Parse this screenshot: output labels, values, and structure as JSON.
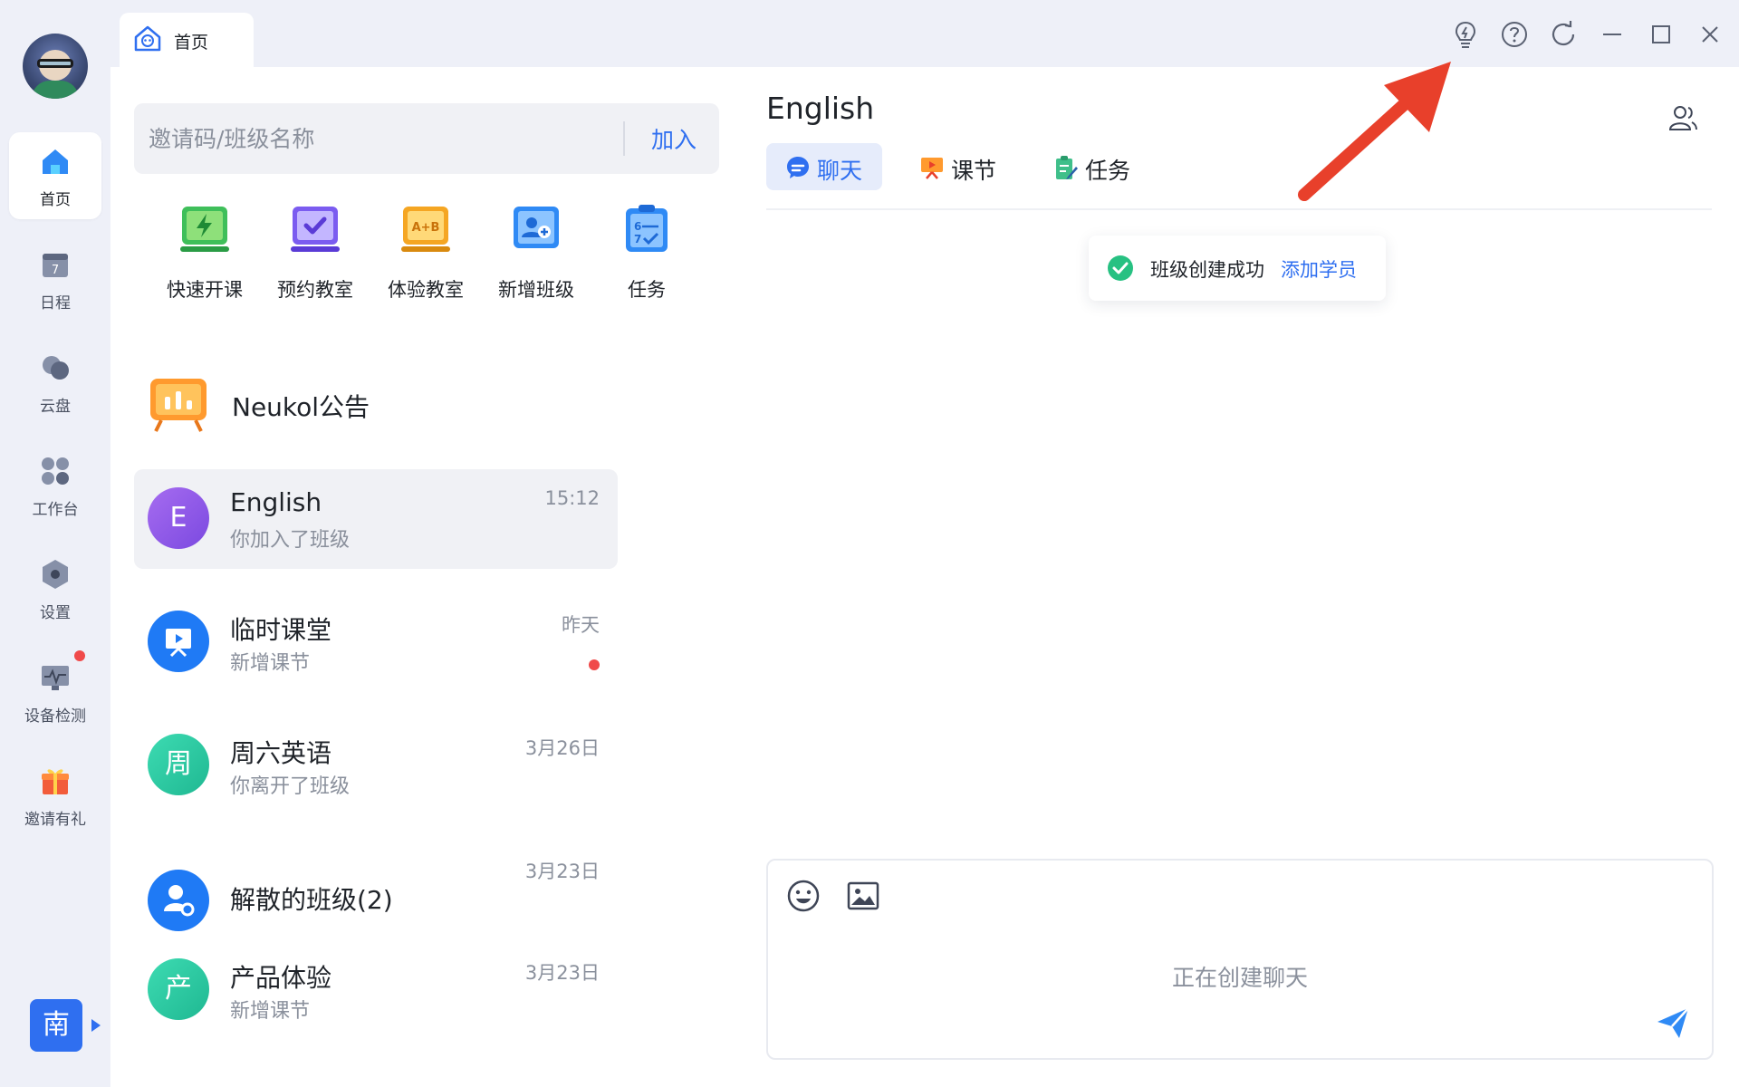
{
  "rail": {
    "items": [
      {
        "label": "首页",
        "icon": "home-icon"
      },
      {
        "label": "日程",
        "icon": "calendar-icon",
        "day": "7"
      },
      {
        "label": "云盘",
        "icon": "cloud-icon"
      },
      {
        "label": "工作台",
        "icon": "workbench-icon"
      },
      {
        "label": "设置",
        "icon": "settings-icon"
      },
      {
        "label": "设备检测",
        "icon": "device-check-icon"
      },
      {
        "label": "邀请有礼",
        "icon": "gift-icon"
      }
    ],
    "user_badge": "南"
  },
  "tabbar": {
    "tab_label": "首页"
  },
  "search": {
    "placeholder": "邀请码/班级名称",
    "join_label": "加入"
  },
  "quick_actions": [
    {
      "label": "快速开课",
      "icon": "quick-class-icon",
      "color": "#3fbf5a"
    },
    {
      "label": "预约教室",
      "icon": "reserve-classroom-icon",
      "color": "#7b5cf0"
    },
    {
      "label": "体验教室",
      "icon": "trial-classroom-icon",
      "color": "#f5a623"
    },
    {
      "label": "新增班级",
      "icon": "add-class-icon",
      "color": "#2f8af5"
    },
    {
      "label": "任务",
      "icon": "task-icon",
      "color": "#2f8af5"
    }
  ],
  "notice": {
    "label": "Neukol公告"
  },
  "conversations": [
    {
      "name": "English",
      "avatar": "E",
      "sub": "你加入了班级",
      "time": "15:12",
      "color": "#8b5ce8",
      "active": true,
      "unread": false
    },
    {
      "name": "临时课堂",
      "avatar": "",
      "sub": "新增课节",
      "time": "昨天",
      "color": "#1f7af5",
      "active": false,
      "unread": true
    },
    {
      "name": "周六英语",
      "avatar": "周",
      "sub": "你离开了班级",
      "time": "3月26日",
      "color": "#25c9a4",
      "active": false,
      "unread": false
    },
    {
      "name": "解散的班级(2)",
      "avatar": "",
      "sub": "",
      "time": "3月23日",
      "color": "#1f7af5",
      "active": false,
      "unread": false
    },
    {
      "name": "产品体验",
      "avatar": "产",
      "sub": "新增课节",
      "time": "3月23日",
      "color": "#25c9a4",
      "active": false,
      "unread": false
    }
  ],
  "chat": {
    "title": "English",
    "tabs": [
      {
        "label": "聊天",
        "icon": "chat-bubble-icon"
      },
      {
        "label": "课节",
        "icon": "lesson-icon"
      },
      {
        "label": "任务",
        "icon": "task-clipboard-icon"
      }
    ],
    "toast_text": "班级创建成功",
    "toast_action": "添加学员",
    "composer_status": "正在创建聊天"
  },
  "colors": {
    "accent": "#2f6ff0",
    "annotation_arrow": "#e8402b",
    "unread_dot": "#f04a4a"
  }
}
